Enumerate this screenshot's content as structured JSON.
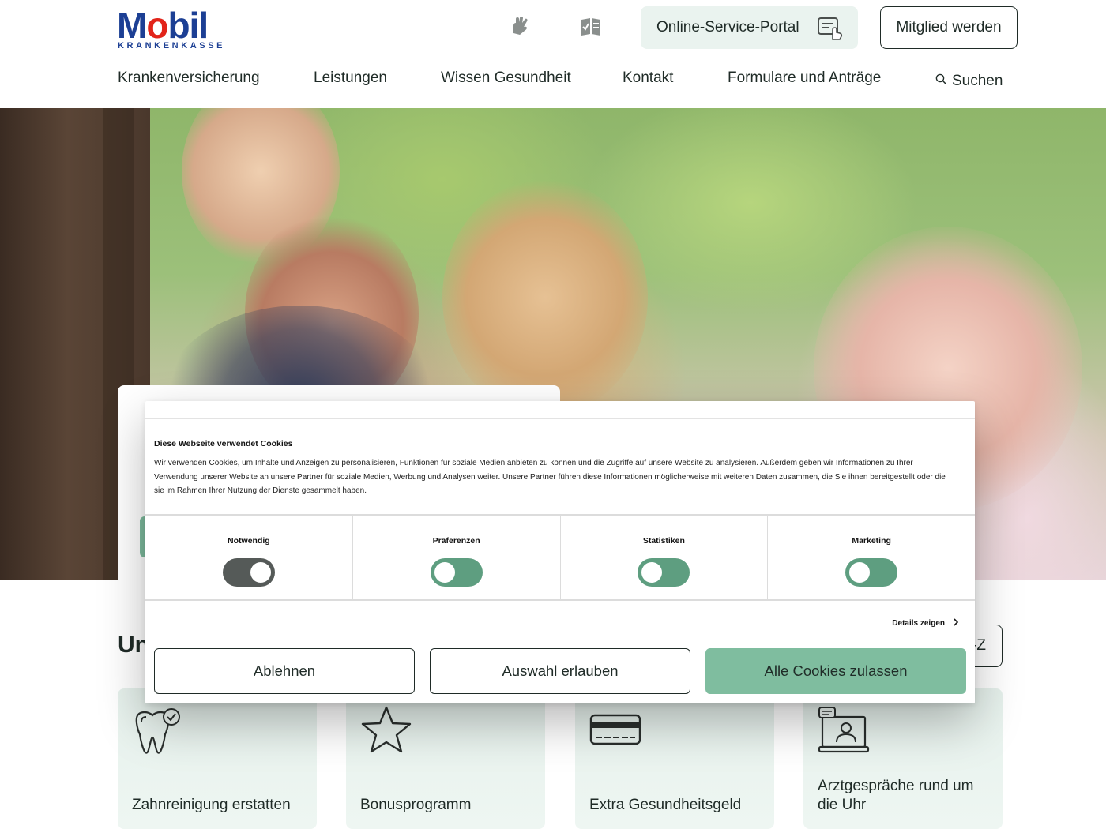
{
  "brand": {
    "name": "Mobil",
    "sub": "KRANKENKASSE",
    "blue": "#1c3f94",
    "red": "#e2241a",
    "accent": "#7fbd9f",
    "tint": "#eaf3ef"
  },
  "header": {
    "icons": [
      "sign-language-icon",
      "easy-language-icon"
    ],
    "portal_label": "Online-Service-Portal",
    "portal_icon": "portal-touch-icon",
    "member_label": "Mitglied werden"
  },
  "nav": {
    "items": [
      "Krankenversicherung",
      "Leistungen",
      "Wissen Gesundheit",
      "Kontakt",
      "Formulare und Anträge"
    ],
    "search_label": "Suchen"
  },
  "section": {
    "title_partial": "Un",
    "az_partial": "-Z"
  },
  "tiles": [
    {
      "label": "Zahnreinigung erstatten",
      "icon": "tooth-check-icon"
    },
    {
      "label": "Bonusprogramm",
      "icon": "star-icon"
    },
    {
      "label": "Extra Gesundheitsgeld",
      "icon": "card-icon"
    },
    {
      "label": "Arztgespräche rund um die Uhr",
      "icon": "video-doctor-icon"
    }
  ],
  "cookie": {
    "title": "Diese Webseite verwendet Cookies",
    "text": "Wir verwenden Cookies, um Inhalte und Anzeigen zu personalisieren, Funktionen für soziale Medien anbieten zu können und die Zugriffe auf unsere Website zu analysieren. Außerdem geben wir Informationen zu Ihrer Verwendung unserer Website an unsere Partner für soziale Medien, Werbung und Analysen weiter. Unsere Partner führen diese Informationen möglicherweise mit weiteren Daten zusammen, die Sie ihnen bereitgestellt oder die sie im Rahmen Ihrer Nutzung der Dienste gesammelt haben.",
    "categories": [
      {
        "label": "Notwendig",
        "on": true,
        "disabled": true
      },
      {
        "label": "Präferenzen",
        "on": false,
        "disabled": false
      },
      {
        "label": "Statistiken",
        "on": false,
        "disabled": false
      },
      {
        "label": "Marketing",
        "on": false,
        "disabled": false
      }
    ],
    "details_label": "Details zeigen",
    "buttons": {
      "reject": "Ablehnen",
      "allow_selection": "Auswahl erlauben",
      "allow_all": "Alle Cookies zulassen"
    },
    "toggle_colors": {
      "disabled": "#555a58",
      "active": "#5e9e80"
    }
  }
}
